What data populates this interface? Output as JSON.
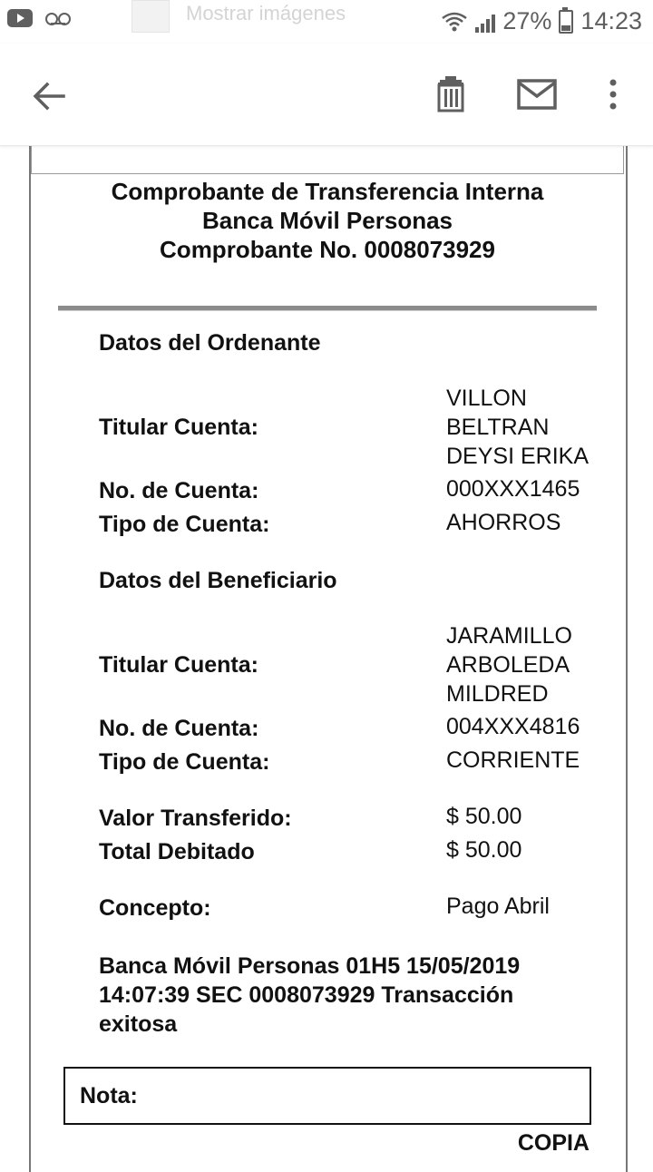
{
  "status_bar": {
    "notification_text": "Mostrar imágenes",
    "battery": "27%",
    "time": "14:23",
    "icons": [
      "youtube-icon",
      "voicemail-icon",
      "wifi-icon",
      "signal-icon",
      "battery-icon"
    ]
  },
  "toolbar": {
    "icons": [
      "back-arrow-icon",
      "trash-icon",
      "mail-icon",
      "more-vert-icon"
    ]
  },
  "receipt": {
    "title_line1": "Comprobante de Transferencia Interna",
    "title_line2": "Banca Móvil Personas",
    "title_line3": "Comprobante No. 0008073929",
    "ordenante": {
      "section_title": "Datos del Ordenante",
      "titular_label": "Titular Cuenta:",
      "titular_value": [
        "VILLON",
        "BELTRAN",
        "DEYSI ERIKA"
      ],
      "cuenta_label": "No. de Cuenta:",
      "cuenta_value": "000XXX1465",
      "tipo_label": "Tipo de Cuenta:",
      "tipo_value": "AHORROS"
    },
    "beneficiario": {
      "section_title": "Datos del Beneficiario",
      "titular_label": "Titular Cuenta:",
      "titular_value": [
        "JARAMILLO",
        "ARBOLEDA",
        "MILDRED"
      ],
      "cuenta_label": "No. de Cuenta:",
      "cuenta_value": "004XXX4816",
      "tipo_label": "Tipo de Cuenta:",
      "tipo_value": "CORRIENTE"
    },
    "valor_label": "Valor Transferido:",
    "valor_value": "$ 50.00",
    "total_label": "Total Debitado",
    "total_value": "$ 50.00",
    "concepto_label": "Concepto:",
    "concepto_value": "Pago Abril",
    "transaction_line1": "Banca Móvil Personas 01H5 15/05/2019",
    "transaction_line2": "14:07:39 SEC 0008073929 Transacción",
    "transaction_line3": "exitosa",
    "nota_label": "Nota:",
    "copia_label": "COPIA"
  }
}
